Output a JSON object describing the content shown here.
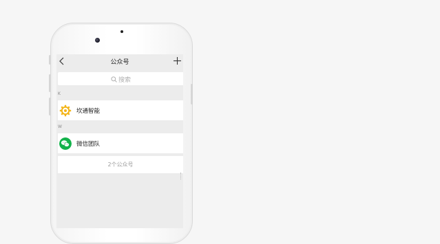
{
  "nav": {
    "title": "公众号"
  },
  "search": {
    "placeholder": "搜索"
  },
  "sections": [
    {
      "letter": "K",
      "account": {
        "name": "坎通智能",
        "icon": "kantong-logo-icon"
      }
    },
    {
      "letter": "W",
      "account": {
        "name": "微信团队",
        "icon": "wechat-logo-icon"
      }
    }
  ],
  "footer": {
    "count_text": "2个公众号"
  },
  "colors": {
    "wechat_green": "#12b24a",
    "kantong_yellow": "#f3b417",
    "background": "#ececec"
  }
}
